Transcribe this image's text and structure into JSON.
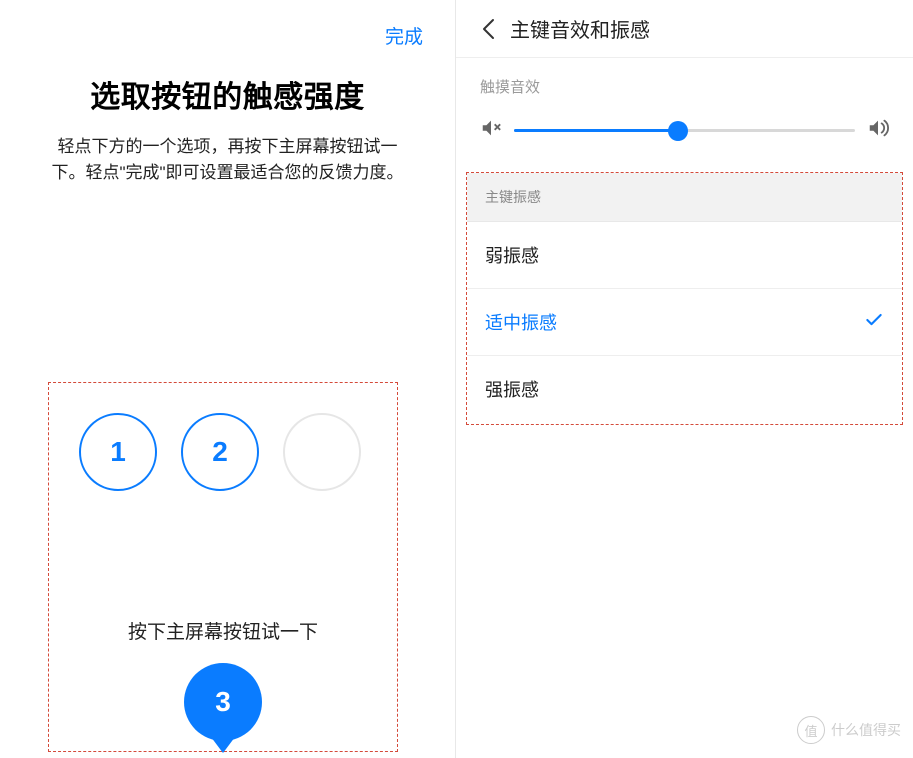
{
  "left": {
    "done": "完成",
    "title": "选取按钮的触感强度",
    "description": "轻点下方的一个选项，再按下主屏幕按钮试一下。轻点\"完成\"即可设置最适合您的反馈力度。",
    "options": {
      "one": "1",
      "two": "2",
      "three": "3"
    },
    "hint": "按下主屏幕按钮试一下"
  },
  "right": {
    "header": "主键音效和振感",
    "touch_sound_label": "触摸音效",
    "slider_percent": 48,
    "vibration_section": "主键振感",
    "options": {
      "weak": "弱振感",
      "medium": "适中振感",
      "strong": "强振感"
    }
  },
  "watermark": {
    "badge": "值",
    "text": "什么值得买"
  }
}
